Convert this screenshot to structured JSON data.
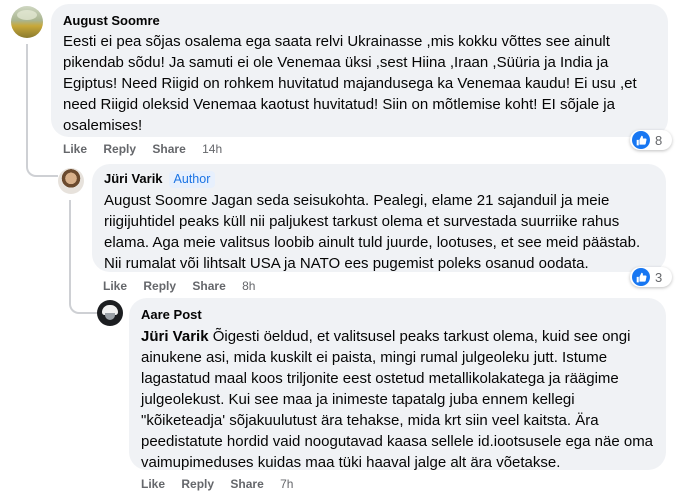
{
  "comments": [
    {
      "author": "August Soomre",
      "text": "Eesti ei pea sõjas osalema ega saata relvi Ukrainasse ,mis kokku võttes see ainult pikendab sõdu! Ja samuti ei ole Venemaa üksi ,sest Hiina ,Iraan ,Süüria ja India ja Egiptus! Need Riigid on rohkem huvitatud majandusega ka Venemaa kaudu! Ei usu ,et need Riigid oleksid Venemaa kaotust huvitatud! Siin on mõtlemise koht! EI sõjale ja osalemises!",
      "actions": {
        "like": "Like",
        "reply": "Reply",
        "share": "Share",
        "time": "14h"
      },
      "reaction_count": "8",
      "reaction_icon": "like-icon"
    },
    {
      "author": "Jüri Varik",
      "badge": "Author",
      "text": "August Soomre Jagan seda seisukohta. Pealegi, elame 21 sajanduil ja meie riigijuhtidel peaks küll nii paljukest tarkust olema et survestada suurriike rahus elama. Aga meie valitsus loobib ainult tuld juurde, lootuses, et see meid päästab. Nii rumalat või lihtsalt USA ja NATO ees pugemist poleks osanud oodata.",
      "actions": {
        "like": "Like",
        "reply": "Reply",
        "share": "Share",
        "time": "8h"
      },
      "reaction_count": "3",
      "reaction_icon": "like-icon"
    },
    {
      "author": "Aare Post",
      "mention": "Jüri Varik",
      "text": " Õigesti öeldud, et valitsusel peaks tarkust olema, kuid see ongi ainukene asi, mida kuskilt ei paista, mingi rumal julgeoleku jutt. Istume lagastatud maal koos triljonite eest ostetud metallikolakatega ja räägime julgeolekust. Kui see maa ja inimeste tapatalg juba ennem kellegi \"kõiketeadja' sõjakuulutust ära tehakse, mida krt siin veel kaitsta. Ära peedistatute hordid vaid noogutavad kaasa sellele id.iootsusele ega näe oma vaimupimeduses kuidas maa tüki haaval jalge alt ära võetakse.",
      "actions": {
        "like": "Like",
        "reply": "Reply",
        "share": "Share",
        "time": "7h"
      }
    }
  ],
  "colors": {
    "bubble": "#f0f2f5",
    "like_blue": "#1877f2",
    "meta_gray": "#65676b",
    "badge_text": "#1b74e4"
  }
}
